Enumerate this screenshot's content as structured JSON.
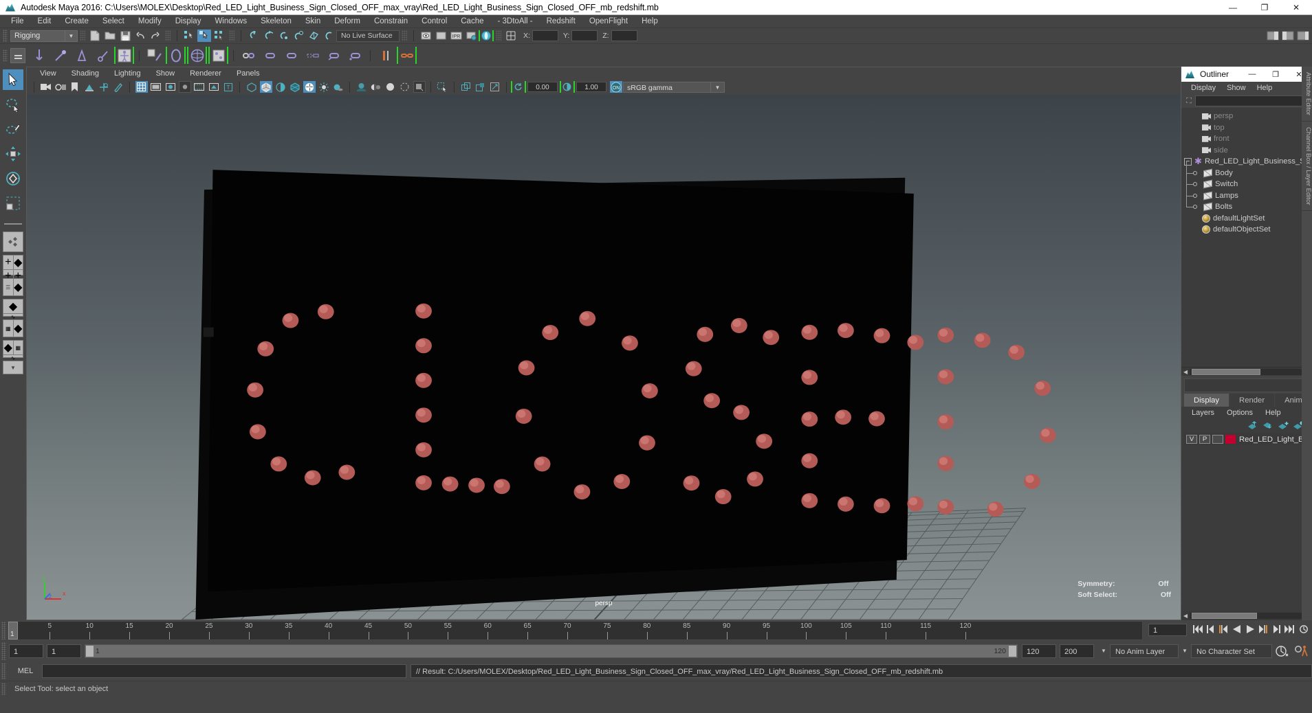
{
  "window": {
    "title": "Autodesk Maya 2016: C:\\Users\\MOLEX\\Desktop\\Red_LED_Light_Business_Sign_Closed_OFF_max_vray\\Red_LED_Light_Business_Sign_Closed_OFF_mb_redshift.mb",
    "minimize": "—",
    "restore": "❐",
    "close": "✕",
    "app_icon": "maya-icon"
  },
  "menubar": {
    "items": [
      "File",
      "Edit",
      "Create",
      "Select",
      "Modify",
      "Display",
      "Windows",
      "Skeleton",
      "Skin",
      "Deform",
      "Constrain",
      "Control",
      "Cache",
      "- 3DtoAll -",
      "Redshift",
      "OpenFlight",
      "Help"
    ]
  },
  "statusline": {
    "menuset": "Rigging",
    "live_surface": "No Live Surface",
    "coord_labels": [
      "X:",
      "Y:",
      "Z:"
    ],
    "coord_values": [
      "",
      "",
      ""
    ],
    "ipr_label": "IPR"
  },
  "viewport_menu": {
    "items": [
      "View",
      "Shading",
      "Lighting",
      "Show",
      "Renderer",
      "Panels"
    ]
  },
  "viewport_tools": {
    "exposure": "0.00",
    "gamma": "1.00",
    "color_mgmt_toggle": "ON",
    "color_space": "sRGB gamma"
  },
  "viewport": {
    "camera_label": "persp",
    "axis": {
      "x": "x",
      "y": "y",
      "z": "z"
    },
    "hud": [
      {
        "label": "Symmetry:",
        "value": "Off"
      },
      {
        "label": "Soft Select:",
        "value": "Off"
      }
    ],
    "scene": {
      "sign_text": "CLOSED",
      "lamp_color": "#c4635f",
      "board_color": "#050505"
    }
  },
  "outliner": {
    "title": "Outliner",
    "window_buttons": {
      "minimize": "—",
      "maximize": "❐",
      "close": "✕"
    },
    "menu": [
      "Display",
      "Show",
      "Help"
    ],
    "search_value": "",
    "search_placeholder": "",
    "items": [
      {
        "label": "persp",
        "icon": "camera-icon",
        "indent": 1,
        "dim": true,
        "type": "camera"
      },
      {
        "label": "top",
        "icon": "camera-icon",
        "indent": 1,
        "dim": true,
        "type": "camera"
      },
      {
        "label": "front",
        "icon": "camera-icon",
        "indent": 1,
        "dim": true,
        "type": "camera"
      },
      {
        "label": "side",
        "icon": "camera-icon",
        "indent": 1,
        "dim": true,
        "type": "camera"
      },
      {
        "label": "Red_LED_Light_Business_Sig",
        "icon": "group-star-icon",
        "indent": 0,
        "dim": false,
        "type": "group",
        "expander": "−"
      },
      {
        "label": "Body",
        "icon": "mesh-icon",
        "indent": 2,
        "dim": false,
        "type": "mesh"
      },
      {
        "label": "Switch",
        "icon": "mesh-icon",
        "indent": 2,
        "dim": false,
        "type": "mesh"
      },
      {
        "label": "Lamps",
        "icon": "mesh-icon",
        "indent": 2,
        "dim": false,
        "type": "mesh"
      },
      {
        "label": "Bolts",
        "icon": "mesh-icon",
        "indent": 2,
        "dim": false,
        "type": "mesh",
        "last": true
      },
      {
        "label": "defaultLightSet",
        "icon": "set-icon",
        "indent": 1,
        "dim": false,
        "type": "set"
      },
      {
        "label": "defaultObjectSet",
        "icon": "set-icon",
        "indent": 1,
        "dim": false,
        "type": "set"
      }
    ]
  },
  "layer_editor": {
    "tabs": [
      {
        "label": "Display",
        "active": true
      },
      {
        "label": "Render",
        "active": false
      },
      {
        "label": "Anim",
        "active": false
      }
    ],
    "menu": [
      "Layers",
      "Options",
      "Help"
    ],
    "layers": [
      {
        "v": "V",
        "p": "P",
        "third": "",
        "color": "#c40030",
        "name": "Red_LED_Light_Busine"
      }
    ]
  },
  "right_tabs": [
    "Attribute Editor",
    "Channel Box / Layer Editor"
  ],
  "timeline": {
    "ticks": [
      5,
      10,
      15,
      20,
      25,
      30,
      35,
      40,
      45,
      50,
      55,
      60,
      65,
      70,
      75,
      80,
      85,
      90,
      95,
      100,
      105,
      110,
      115,
      120
    ],
    "start": 1,
    "end": 120,
    "current_frame": "1",
    "cursor_label": "1"
  },
  "range": {
    "anim_start": "1",
    "range_start": "1",
    "slider_start": "1",
    "slider_end": "120",
    "range_end": "120",
    "anim_end": "200",
    "anim_layer": "No Anim Layer",
    "character_set": "No Character Set"
  },
  "command_line": {
    "language": "MEL",
    "input_value": "",
    "result": "// Result: C:/Users/MOLEX/Desktop/Red_LED_Light_Business_Sign_Closed_OFF_max_vray/Red_LED_Light_Business_Sign_Closed_OFF_mb_redshift.mb"
  },
  "status_bar": {
    "message": "Select Tool: select an object"
  }
}
